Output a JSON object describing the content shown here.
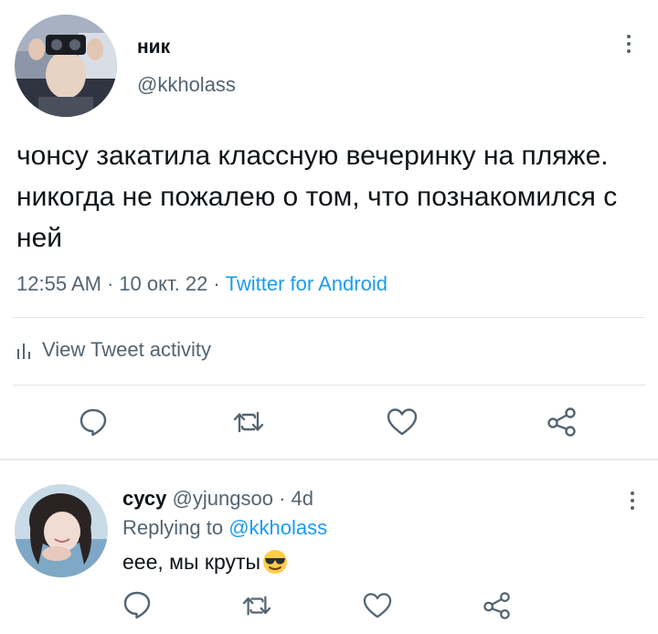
{
  "main_tweet": {
    "display_name": "ник",
    "handle": "@kkholass",
    "text": "чонсу закатила классную вечеринку на пляже. никогда не пожалею о том, что познакомился с ней",
    "time": "12:55 AM",
    "separator": "·",
    "date": "10 окт. 22",
    "source": "Twitter for Android",
    "activity_label": "View Tweet activity",
    "actions": [
      "reply-icon",
      "retweet-icon",
      "like-icon",
      "share-icon"
    ]
  },
  "reply": {
    "display_name": "сусу",
    "handle": "@yjungsoo",
    "dot": "·",
    "time": "4d",
    "replying_prefix": "Replying to",
    "replying_to": "@kkholass",
    "text": "еее, мы круты",
    "emoji": "smiling-face-with-sunglasses",
    "actions": [
      "reply-icon",
      "retweet-icon",
      "like-icon",
      "share-icon"
    ]
  },
  "colors": {
    "text": "#0f1419",
    "secondary": "#536471",
    "link": "#1d9bf0",
    "divider": "#e3e6e8"
  }
}
